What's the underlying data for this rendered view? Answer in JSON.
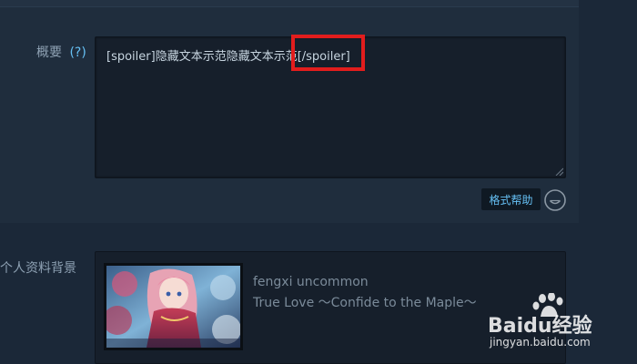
{
  "summary_section": {
    "label": "概要",
    "help_link": "(?)",
    "textarea_value": "[spoiler]隐藏文本示范隐藏文本示范[/spoiler]"
  },
  "toolbar": {
    "format_help_label": "格式帮助",
    "emoticon_icon": "smiley-icon"
  },
  "profile_background": {
    "label": "个人资料背景",
    "item_name": "fengxi uncommon",
    "item_subtitle": "True Love ～Confide to the Maple～"
  },
  "watermark": {
    "brand": "Baidu经验",
    "url": "jingyan.baidu.com"
  },
  "colors": {
    "page_bg": "#1b2838",
    "panel_bg": "#1f2d3d",
    "input_bg": "#161f2b",
    "link_blue": "#66c0f4",
    "annotation_red": "#e21d1d"
  }
}
